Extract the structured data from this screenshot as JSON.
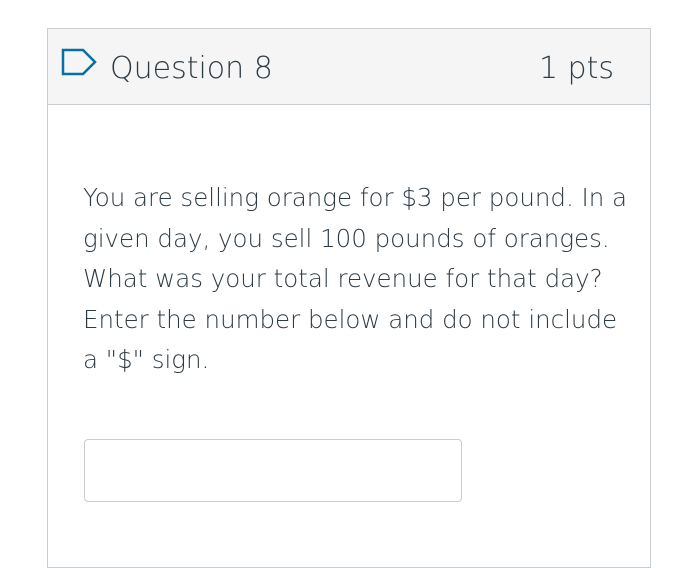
{
  "question": {
    "title": "Question 8",
    "points": "1 pts",
    "flag_icon": "flag-outline-icon",
    "text": "You are selling orange for $3 per pound. In a given day, you sell 100 pounds of oranges. What was your total revenue for that day? Enter the number below and do not include a \"$\" sign.",
    "answer": {
      "value": "",
      "placeholder": ""
    }
  },
  "colors": {
    "header_background": "#f5f5f5",
    "border": "#c7cdd1",
    "text": "#2d3b45",
    "flag_stroke": "#0770a3"
  }
}
